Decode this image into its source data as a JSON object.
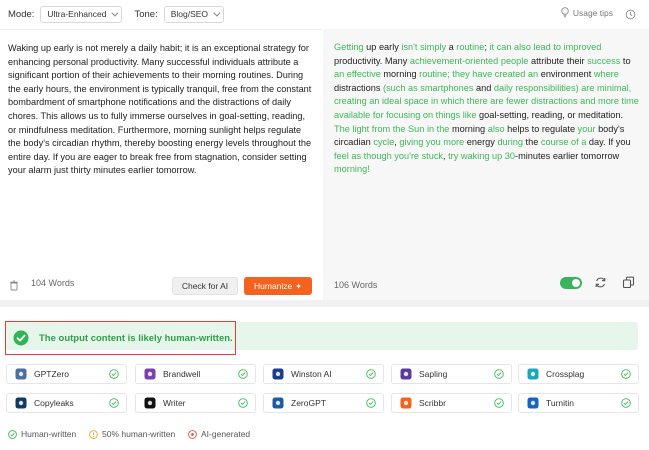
{
  "toolbar": {
    "mode_label": "Mode:",
    "mode_value": "Ultra-Enhanced",
    "tone_label": "Tone:",
    "tone_value": "Blog/SEO",
    "usage_tips": "Usage tips"
  },
  "input": {
    "text": "Waking up early is not merely a daily habit; it is an exceptional strategy for enhancing personal productivity. Many successful individuals attribute a significant portion of their achievements to their morning routines. During the early hours, the environment is typically tranquil, free from the constant bombardment of smartphone notifications and the distractions of daily chores. This allows us to fully immerse ourselves in goal-setting, reading, or mindfulness meditation. Furthermore, morning sunlight helps regulate the body's circadian rhythm, thereby boosting energy levels throughout the entire day. If you are eager to break free from stagnation, consider setting your alarm just thirty minutes earlier tomorrow.",
    "word_count": "104 Words",
    "check_label": "Check for AI",
    "humanize_label": "Humanize"
  },
  "output": {
    "segments": [
      {
        "t": "Getting",
        "h": true
      },
      {
        "t": " up early ",
        "h": false
      },
      {
        "t": "isn't simply",
        "h": true
      },
      {
        "t": " a ",
        "h": false
      },
      {
        "t": "routine",
        "h": true
      },
      {
        "t": "; ",
        "h": false
      },
      {
        "t": "it can also lead to improved",
        "h": true
      },
      {
        "t": " productivity. Many ",
        "h": false
      },
      {
        "t": "achievement-oriented people",
        "h": true
      },
      {
        "t": " attribute their ",
        "h": false
      },
      {
        "t": "success",
        "h": true
      },
      {
        "t": " to ",
        "h": false
      },
      {
        "t": "an effective",
        "h": true
      },
      {
        "t": " morning ",
        "h": false
      },
      {
        "t": "routine; they have created an",
        "h": true
      },
      {
        "t": " environment ",
        "h": false
      },
      {
        "t": "where",
        "h": true
      },
      {
        "t": " distractions ",
        "h": false
      },
      {
        "t": "(such as smartphones",
        "h": true
      },
      {
        "t": " and ",
        "h": false
      },
      {
        "t": "daily",
        "h": true
      },
      {
        "t": " ",
        "h": false
      },
      {
        "t": "responsibilities) are minimal, creating an ideal space",
        "h": true
      },
      {
        "t": " in which there are fewer distractions and more time available for focusing on things like",
        "h": true
      },
      {
        "t": " goal-setting, reading, or meditation. ",
        "h": false
      },
      {
        "t": "The light from the Sun in the",
        "h": true
      },
      {
        "t": " morning ",
        "h": false
      },
      {
        "t": "also",
        "h": true
      },
      {
        "t": " helps to regulate ",
        "h": false
      },
      {
        "t": "your",
        "h": true
      },
      {
        "t": " body's circadian ",
        "h": false
      },
      {
        "t": "cycle",
        "h": true
      },
      {
        "t": ", ",
        "h": false
      },
      {
        "t": "giving you more",
        "h": true
      },
      {
        "t": " energy ",
        "h": false
      },
      {
        "t": "during",
        "h": true
      },
      {
        "t": " the ",
        "h": false
      },
      {
        "t": "course of a",
        "h": true
      },
      {
        "t": " day. If you ",
        "h": false
      },
      {
        "t": "feel as though you're stuck",
        "h": true
      },
      {
        "t": ", ",
        "h": false
      },
      {
        "t": "try waking up 30",
        "h": true
      },
      {
        "t": "-minutes earlier tomorrow ",
        "h": false
      },
      {
        "t": "morning!",
        "h": true
      }
    ],
    "word_count": "106 Words"
  },
  "result": {
    "message": "The output content is likely human-written."
  },
  "detectors": [
    {
      "name": "GPTZero",
      "logo": "gptzero-logo",
      "color": "#4a6fa5"
    },
    {
      "name": "Brandwell",
      "logo": "brandwell-logo",
      "color": "#7a3fb0"
    },
    {
      "name": "Winston AI",
      "logo": "winston-logo",
      "color": "#1b3d8f"
    },
    {
      "name": "Sapling",
      "logo": "sapling-logo",
      "color": "#5b3aa0"
    },
    {
      "name": "Crossplag",
      "logo": "crossplag-logo",
      "color": "#1aa7b8"
    },
    {
      "name": "Copyleaks",
      "logo": "copyleaks-logo",
      "color": "#0e3a64"
    },
    {
      "name": "Writer",
      "logo": "writer-logo",
      "color": "#111111"
    },
    {
      "name": "ZeroGPT",
      "logo": "zerogpt-logo",
      "color": "#1c5aa8"
    },
    {
      "name": "Scribbr",
      "logo": "scribbr-logo",
      "color": "#f4621f"
    },
    {
      "name": "Turnitin",
      "logo": "turnitin-logo",
      "color": "#1565c0"
    }
  ],
  "legend": {
    "human": "Human-written",
    "half": "50% human-written",
    "ai": "AI-generated"
  },
  "colors": {
    "accent": "#f4621f",
    "success": "#3db858",
    "alert_border": "#e43a3a"
  }
}
